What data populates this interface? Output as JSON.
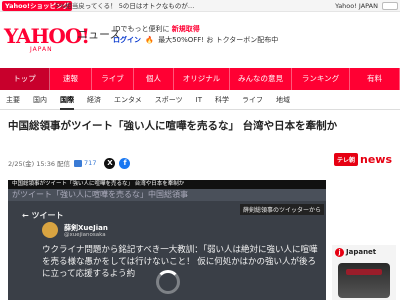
{
  "topbar": {
    "promo_badge": "Yahoo!ショッピング",
    "promo_text": "5%相当戻ってくる！ 5の日はオトクなものが…",
    "right_text": "Yahoo! JAPAN"
  },
  "header": {
    "logo": "YAHOO!",
    "logo_sub": "JAPAN",
    "service": "ニュース",
    "line1_prefix": "IDでもっと便利に",
    "line1_highlight": "新規取得",
    "login": "ログイン",
    "line2_text": "最大50%OFF! お トクターボン配布中"
  },
  "mainnav": {
    "items": [
      {
        "label": "トップ",
        "width": 50
      },
      {
        "label": "速報",
        "width": 42
      },
      {
        "label": "ライブ",
        "width": 42
      },
      {
        "label": "個人",
        "width": 40
      },
      {
        "label": "オリジナル",
        "width": 56
      },
      {
        "label": "みんなの意見",
        "width": 62
      },
      {
        "label": "ランキング",
        "width": 58
      },
      {
        "label": "有料",
        "width": 50
      }
    ]
  },
  "subnav": {
    "items": [
      {
        "label": "主要"
      },
      {
        "label": "国内"
      },
      {
        "label": "国際"
      },
      {
        "label": "経済"
      },
      {
        "label": "エンタメ"
      },
      {
        "label": "スポーツ"
      },
      {
        "label": "IT"
      },
      {
        "label": "科学"
      },
      {
        "label": "ライフ"
      },
      {
        "label": "地域"
      }
    ],
    "active_index": 2
  },
  "article": {
    "headline": "中国総領事がツイート「強い人に喧嘩を売るな」 台湾や日本を牽制か",
    "date": "2/25(金) 15:36 配信",
    "comment_count": "717",
    "source_badge": "テレ朝",
    "source_name": "news"
  },
  "video": {
    "caption": "中国総領事がツイート「強い人に喧嘩を売るな」 台湾や日本を牽制か",
    "ticker": "がツイート「強い人に喧嘩を売るな」中国総領事",
    "tag": "薛剣総領事のツイッターから",
    "tweet_head": "←  ツイート",
    "name": "薛剣XueJian",
    "handle": "@xuejianosaka",
    "body": "ウクライナ問題から銘記すべき一大教訓：「弱い人は絶対に強い人に喧嘩を売る様な愚かをしては行けないこと！ 仮に何処かはかの強い人が後ろに立って応援するよう約"
  },
  "ad": {
    "brand": "Japanet",
    "badge": "j"
  }
}
